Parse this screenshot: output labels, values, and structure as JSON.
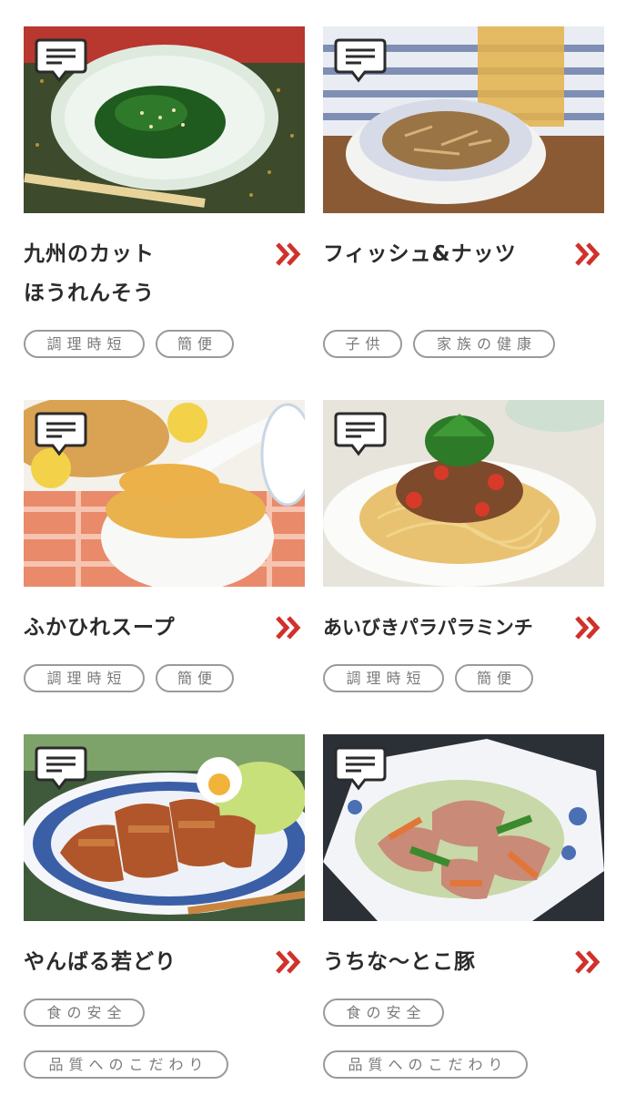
{
  "colors": {
    "title": "#2b2b2b",
    "chevron": "#d0322b",
    "tag_border": "#9a9a9a",
    "tag_text": "#7a7a7a"
  },
  "icons": {
    "comment": "comment-bubble-icon",
    "more": "double-chevron-right-icon"
  },
  "recipes": [
    {
      "title": "九州のカット\nほうれんそう",
      "image": "spinach-dish-photo",
      "tags": [
        "調理時短",
        "簡便"
      ]
    },
    {
      "title": "フィッシュ&ナッツ",
      "image": "fish-and-nuts-dish-photo",
      "tags": [
        "子供",
        "家族の健康"
      ]
    },
    {
      "title": "ふかひれスープ",
      "image": "shark-fin-soup-photo",
      "tags": [
        "調理時短",
        "簡便"
      ]
    },
    {
      "title": "あいびきパラパラミンチ",
      "image": "minced-meat-pasta-photo",
      "tags": [
        "調理時短",
        "簡便"
      ]
    },
    {
      "title": "やんばる若どり",
      "image": "grilled-chicken-photo",
      "tags": [
        "食の安全",
        "品質へのこだわり"
      ]
    },
    {
      "title": "うちな〜とこ豚",
      "image": "pork-stir-fry-photo",
      "tags": [
        "食の安全",
        "品質へのこだわり"
      ]
    }
  ]
}
